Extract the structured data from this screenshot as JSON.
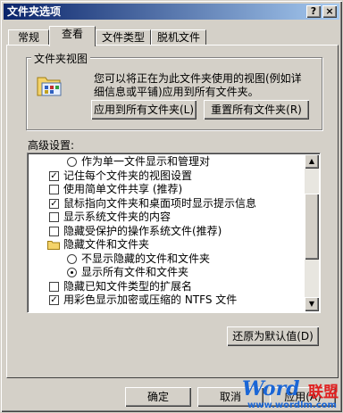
{
  "window": {
    "title": "文件夹选项",
    "help_button": "?",
    "close_button": "×"
  },
  "tabs": [
    {
      "label": "常规"
    },
    {
      "label": "查看"
    },
    {
      "label": "文件类型"
    },
    {
      "label": "脱机文件"
    }
  ],
  "folder_views": {
    "legend": "文件夹视图",
    "description": "您可以将正在为此文件夹使用的视图(例如详细信息或平铺)应用到所有文件夹。",
    "apply_all_button": "应用到所有文件夹(L)",
    "reset_all_button": "重置所有文件夹(R)"
  },
  "advanced": {
    "label": "高级设置:",
    "items": [
      {
        "type": "radio",
        "checked": false,
        "text": "作为单一文件显示和管理对"
      },
      {
        "type": "checkbox",
        "checked": true,
        "text": "记住每个文件夹的视图设置"
      },
      {
        "type": "checkbox",
        "checked": false,
        "text": "使用简单文件共享 (推荐)"
      },
      {
        "type": "checkbox",
        "checked": true,
        "text": "鼠标指向文件夹和桌面项时显示提示信息"
      },
      {
        "type": "checkbox",
        "checked": false,
        "text": "显示系统文件夹的内容"
      },
      {
        "type": "checkbox",
        "checked": false,
        "text": "隐藏受保护的操作系统文件(推荐)"
      },
      {
        "type": "folder",
        "checked": false,
        "text": "隐藏文件和文件夹"
      },
      {
        "type": "radio",
        "checked": false,
        "text": "不显示隐藏的文件和文件夹"
      },
      {
        "type": "radio",
        "checked": true,
        "text": "显示所有文件和文件夹"
      },
      {
        "type": "checkbox",
        "checked": false,
        "text": "隐藏已知文件类型的扩展名"
      },
      {
        "type": "checkbox",
        "checked": true,
        "text": "用彩色显示加密或压缩的 NTFS 文件"
      }
    ],
    "restore_defaults_button": "还原为默认值(D)"
  },
  "footer": {
    "ok_button": "确定",
    "cancel_button": "取消",
    "apply_button": "应用(A)"
  },
  "watermark": {
    "brand": "Word",
    "brand_cn": "联盟",
    "url": "www.wordlm.com"
  }
}
